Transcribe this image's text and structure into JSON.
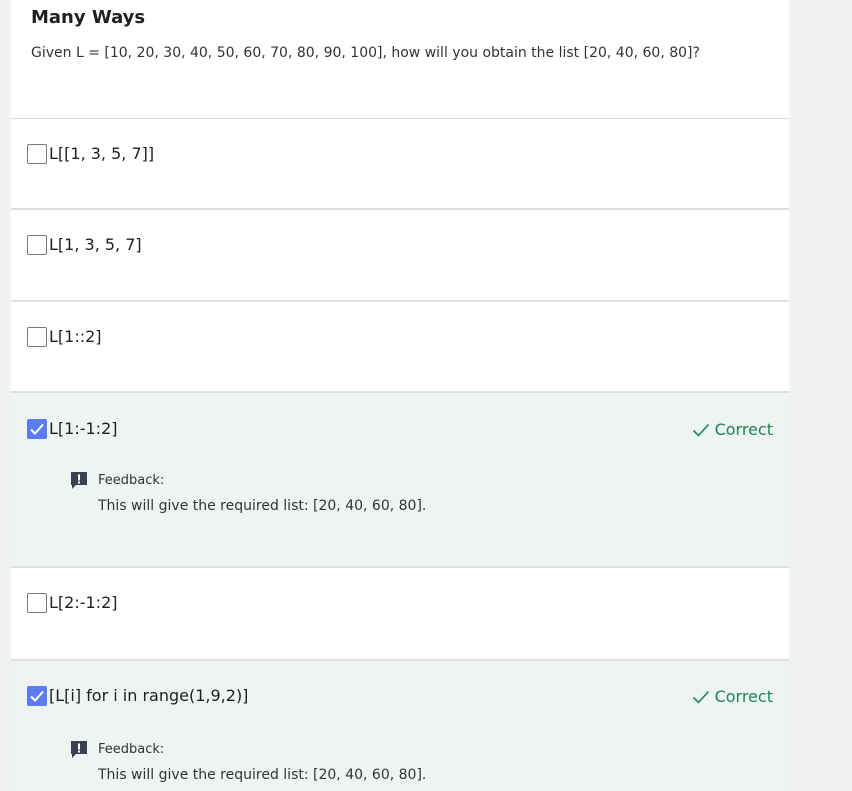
{
  "quiz": {
    "title": "Many Ways",
    "question": "Given L = [10, 20, 30, 40, 50, 60, 70, 80, 90, 100], how will you obtain the list [20, 40, 60, 80]?"
  },
  "options": [
    {
      "label": "L[[1, 3, 5, 7]]",
      "checked": false
    },
    {
      "label": "L[1, 3, 5, 7]",
      "checked": false
    },
    {
      "label": "L[1::2]",
      "checked": false
    },
    {
      "label": "L[1:-1:2]",
      "checked": true,
      "status": "Correct",
      "feedback_label": "Feedback:",
      "feedback_text": "This will give the required list: [20, 40, 60, 80]."
    },
    {
      "label": "L[2:-1:2]",
      "checked": false
    },
    {
      "label": "[L[i] for i in range(1,9,2)]",
      "checked": true,
      "status": "Correct",
      "feedback_label": "Feedback:",
      "feedback_text": "This will give the required list: [20, 40, 60, 80]."
    }
  ],
  "colors": {
    "accent": "#5b7cf5",
    "correct_text": "#1f8354",
    "correct_bg": "#edf4f1"
  },
  "icons": {
    "check": "checkmark-icon",
    "feedback": "feedback-exclamation-icon"
  }
}
